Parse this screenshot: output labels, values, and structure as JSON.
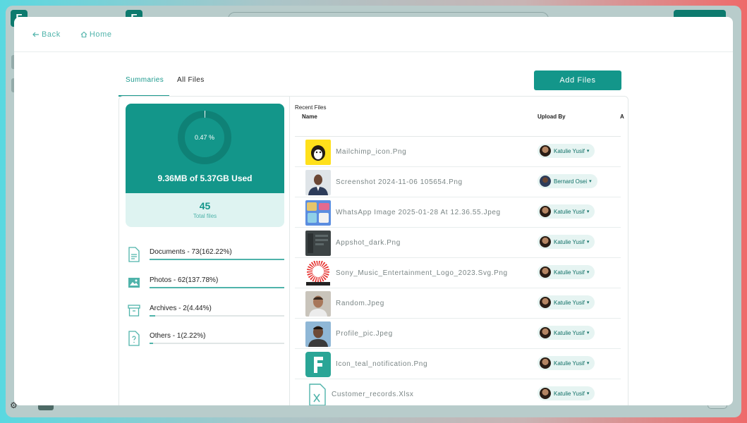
{
  "nav": {
    "back": "Back",
    "home": "Home"
  },
  "tabs": [
    {
      "label": "Summaries",
      "active": true
    },
    {
      "label": "All Files",
      "active": false
    }
  ],
  "add_files": "Add Files",
  "storage": {
    "percent_label": "0.47 %",
    "percent": 0.47,
    "used_label": "9.36MB of 5.37GB Used",
    "total_files": "45",
    "total_label": "Total files"
  },
  "categories": [
    {
      "label": "Documents - 73(162.22%)",
      "fill": 1.0,
      "icon": "document-icon"
    },
    {
      "label": "Photos - 62(137.78%)",
      "fill": 1.0,
      "icon": "photo-icon"
    },
    {
      "label": "Archives - 2(4.44%)",
      "fill": 0.0444,
      "icon": "archive-icon"
    },
    {
      "label": "Others - 1(2.22%)",
      "fill": 0.0222,
      "icon": "unknown-file-icon"
    }
  ],
  "recent": {
    "title": "Recent Files",
    "col_name": "Name",
    "col_upload": "Upload By",
    "col_more": "A",
    "files": [
      {
        "name": "Mailchimp_icon.Png",
        "uploader": "Katulie Yusif",
        "thumb": "mailchimp-thumbnail"
      },
      {
        "name": "Screenshot 2024-11-06 105654.Png",
        "uploader": "Bernard Osei",
        "thumb": "portrait-thumbnail"
      },
      {
        "name": "WhatsApp Image 2025-01-28 At 12.36.55.Jpeg",
        "uploader": "Katulie Yusif",
        "thumb": "collage-thumbnail"
      },
      {
        "name": "Appshot_dark.Png",
        "uploader": "Katulie Yusif",
        "thumb": "dark-app-thumbnail"
      },
      {
        "name": "Sony_Music_Entertainment_Logo_2023.Svg.Png",
        "uploader": "Katulie Yusif",
        "thumb": "sony-logo-thumbnail"
      },
      {
        "name": "Random.Jpeg",
        "uploader": "Katulie Yusif",
        "thumb": "photo-thumbnail"
      },
      {
        "name": "Profile_pic.Jpeg",
        "uploader": "Katulie Yusif",
        "thumb": "profile-thumbnail"
      },
      {
        "name": "Icon_teal_notification.Png",
        "uploader": "Katulie Yusif",
        "thumb": "teal-logo-thumbnail"
      },
      {
        "name": "Customer_records.Xlsx",
        "uploader": "Katulie Yusif",
        "thumb": "spreadsheet-icon"
      }
    ]
  },
  "colors": {
    "accent": "#13968a",
    "light_accent": "#def3f1",
    "link": "#4fb3aa"
  }
}
